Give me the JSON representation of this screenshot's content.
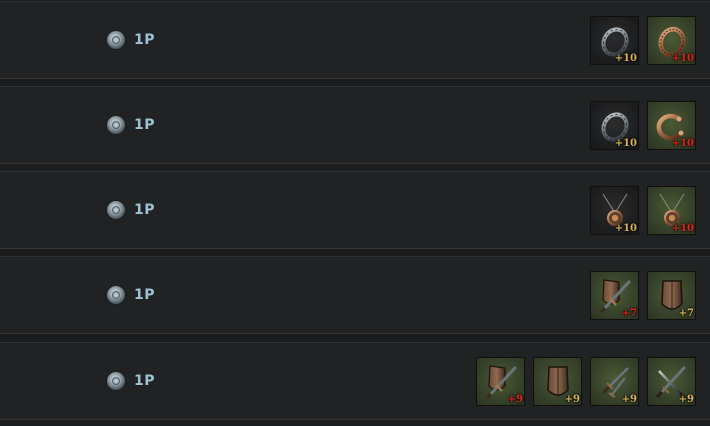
{
  "colors": {
    "gold": "#d7b35b",
    "red": "#e2241b",
    "cost_text": "#9cc2d3"
  },
  "rows": [
    {
      "cost": {
        "icon": "silver-coin-icon",
        "label": "1P"
      },
      "items": [
        {
          "icon": "ring-icon",
          "level": "+10",
          "bg": "base",
          "level_color": "gold"
        },
        {
          "icon": "ornate-ring-icon",
          "level": "+10",
          "bg": "green",
          "level_color": "red"
        }
      ]
    },
    {
      "cost": {
        "icon": "silver-coin-icon",
        "label": "1P"
      },
      "items": [
        {
          "icon": "ring-icon",
          "level": "+10",
          "bg": "base",
          "level_color": "gold"
        },
        {
          "icon": "open-ring-icon",
          "level": "+10",
          "bg": "green",
          "level_color": "red"
        }
      ]
    },
    {
      "cost": {
        "icon": "silver-coin-icon",
        "label": "1P"
      },
      "items": [
        {
          "icon": "necklace-icon",
          "level": "+10",
          "bg": "base",
          "level_color": "gold"
        },
        {
          "icon": "necklace-icon",
          "level": "+10",
          "bg": "green",
          "level_color": "red"
        }
      ]
    },
    {
      "cost": {
        "icon": "silver-coin-icon",
        "label": "1P"
      },
      "items": [
        {
          "icon": "sword-shield-icon",
          "level": "+7",
          "bg": "green",
          "level_color": "red"
        },
        {
          "icon": "shield-icon",
          "level": "+7",
          "bg": "green",
          "level_color": "gold"
        }
      ]
    },
    {
      "cost": {
        "icon": "silver-coin-icon",
        "label": "1P"
      },
      "items": [
        {
          "icon": "sword-shield-icon",
          "level": "+9",
          "bg": "green",
          "level_color": "red"
        },
        {
          "icon": "shield-icon",
          "level": "+9",
          "bg": "green",
          "level_color": "gold"
        },
        {
          "icon": "daggers-icon",
          "level": "+9",
          "bg": "green",
          "level_color": "gold"
        },
        {
          "icon": "crossed-swords-icon",
          "level": "+9",
          "bg": "green",
          "level_color": "gold"
        }
      ]
    }
  ]
}
